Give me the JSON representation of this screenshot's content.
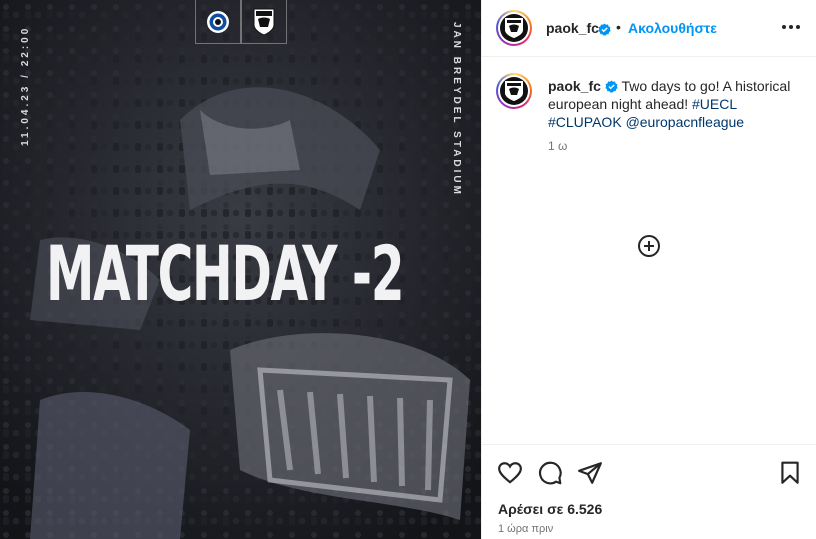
{
  "post": {
    "username": "paok_fc",
    "follow_label": "Ακολουθήστε",
    "separator": "•",
    "caption": {
      "text": "Two days to go! A historical european night ahead! ",
      "hashtags": [
        "#UECL",
        "#CLUPAOK"
      ],
      "mention": "@europacnfleague",
      "age": "1 ω"
    },
    "likes_label": "Αρέσει σε 6.526",
    "timestamp": "1 ώρα πριν"
  },
  "media": {
    "headline": "MATCHDAY -2",
    "date_time": "11.04.23 / 22:00",
    "venue": "JAN BREYDEL STADIUM",
    "crests": [
      "club-brugge-crest",
      "paok-crest"
    ]
  },
  "icons": {
    "verified": "verified-badge-icon",
    "more": "more-options-icon",
    "add": "plus-circle-icon",
    "like": "heart-icon",
    "comment": "comment-bubble-icon",
    "share": "paper-plane-icon",
    "save": "bookmark-icon"
  },
  "colors": {
    "link_blue": "#0095f6",
    "hashtag_blue": "#00376b",
    "verified_blue": "#0095f6",
    "muted_text": "#737373",
    "media_background": "#1c1d22"
  }
}
